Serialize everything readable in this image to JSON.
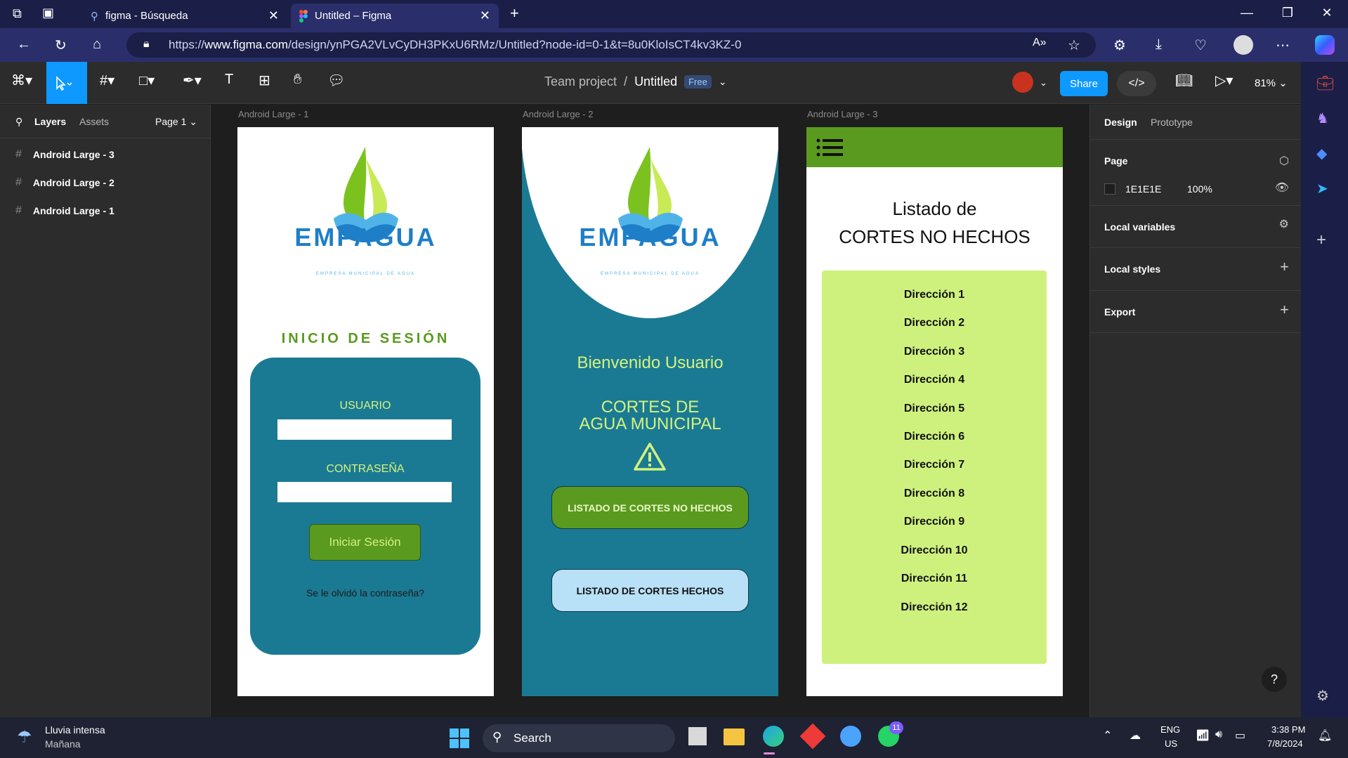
{
  "browser": {
    "tabs": [
      {
        "label": "figma - Búsqueda",
        "icon": "search-icon"
      },
      {
        "label": "Untitled – Figma",
        "icon": "figma-icon"
      }
    ],
    "url_prefix": "https://",
    "url_domain": "www.figma.com",
    "url_path": "/design/ynPGA2VLvCyDH3PKxU6RMz/Untitled?node-id=0-1&t=8u0KloIsCT4kv3KZ-0"
  },
  "figma": {
    "team": "Team project",
    "separator": "/",
    "file": "Untitled",
    "plan_badge": "Free",
    "share_label": "Share",
    "zoom": "81%",
    "left_panel": {
      "tab_layers": "Layers",
      "tab_assets": "Assets",
      "page_selector": "Page 1",
      "layers": [
        "Android Large - 3",
        "Android Large - 2",
        "Android Large - 1"
      ]
    },
    "right_panel": {
      "tab_design": "Design",
      "tab_prototype": "Prototype",
      "page_label": "Page",
      "page_color_hex": "1E1E1E",
      "page_opacity": "100%",
      "local_variables": "Local variables",
      "local_styles": "Local styles",
      "export": "Export"
    },
    "help": "?"
  },
  "frames": {
    "f1": {
      "label": "Android Large - 1",
      "brand": "EMPAGUA",
      "brand_sub": "EMPRESA MUNICIPAL DE AGUA",
      "title": "INICIO DE SESIÓN",
      "user_label": "USUARIO",
      "password_label": "CONTRASEÑA",
      "login_button": "Iniciar Sesión",
      "forgot": "Se le olvidó la contraseña?"
    },
    "f2": {
      "label": "Android Large - 2",
      "brand": "EMPAGUA",
      "brand_sub": "EMPRESA MUNICIPAL DE AGUA",
      "welcome": "Bienvenido Usuario",
      "cortes_line1": "CORTES DE",
      "cortes_line2": "AGUA MUNICIPAL",
      "button1": "LISTADO DE CORTES NO HECHOS",
      "button2": "LISTADO DE CORTES HECHOS"
    },
    "f3": {
      "label": "Android Large - 3",
      "title_line1": "Listado de",
      "title_line2": "CORTES NO HECHOS",
      "items": [
        "Dirección 1",
        "Dirección 2",
        "Dirección 3",
        "Dirección 4",
        "Dirección 5",
        "Dirección 6",
        "Dirección 7",
        "Dirección 8",
        "Dirección 9",
        "Dirección 10",
        "Dirección 11",
        "Dirección 12"
      ]
    }
  },
  "taskbar": {
    "weather_title": "Lluvia intensa",
    "weather_sub": "Mañana",
    "search_label": "Search",
    "whatsapp_badge": "11",
    "lang_top": "ENG",
    "lang_bottom": "US",
    "time": "3:38 PM",
    "date": "7/8/2024"
  },
  "colors": {
    "figma_blue": "#0d99ff",
    "app_teal": "#1b7a93",
    "app_green": "#5a9a1f",
    "app_lime": "#d4f27e",
    "list_bg": "#cef17e",
    "browser_dark": "#1b1f47"
  }
}
